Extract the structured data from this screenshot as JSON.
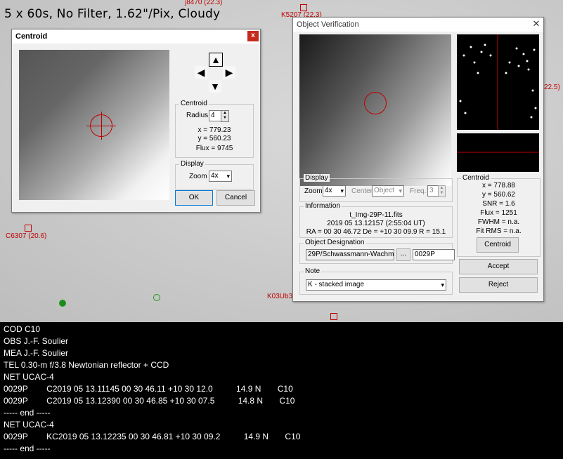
{
  "overlay": {
    "title": "5 x 60s, No Filter, 1.62\"/Pix, Cloudy",
    "marks": [
      "j8470 (22.3)",
      "K5207 (22.3)",
      "C6307 (20.6)",
      "K03Ub3",
      "22.5)"
    ]
  },
  "centroid_window": {
    "title": "Centroid",
    "close_label": "x",
    "group_label": "Centroid",
    "radius_label": "Radius",
    "radius_value": "4",
    "x": "x = 779.23",
    "y": "y = 560.23",
    "flux": "Flux = 9745",
    "display_label": "Display",
    "zoom_label": "Zoom",
    "zoom_value": "4x",
    "ok_label": "OK",
    "cancel_label": "Cancel",
    "arrows": {
      "up": "▲",
      "down": "▼",
      "left": "◀",
      "right": "▶"
    }
  },
  "verify_window": {
    "title": "Object Verification",
    "close_label": "✕",
    "display_label": "Display",
    "zoom_label": "Zoom",
    "zoom_value": "4x",
    "center_label": "Center",
    "center_value": "Object",
    "freq_label": "Freq.",
    "freq_value": "3",
    "info_label": "Information",
    "info_file": "t_Img-29P-11.fits",
    "info_date": "2019 05 13.12157 (2:55:04 UT)",
    "info_coords": "RA = 00 30 46.72   De = +10 30 09.9   R = 15.1",
    "designation_label": "Object Designation",
    "designation_value": "29P/Schwassmann-Wachm",
    "browse_label": "...",
    "designation_code": "0029P",
    "note_label": "Note",
    "note_value": "K - stacked image",
    "centroid_label": "Centroid",
    "c_x": "x = 778.88",
    "c_y": "y = 560.62",
    "c_snr": "SNR = 1.6",
    "c_flux": "Flux = 1251",
    "c_fwhm": "FWHM = n.a.",
    "c_fitrms": "Fit RMS = n.a.",
    "centroid_button": "Centroid",
    "accept_button": "Accept",
    "reject_button": "Reject"
  },
  "console_lines": [
    "COD C10",
    "OBS J.-F. Soulier",
    "MEA J.-F. Soulier",
    "TEL 0.30-m f/3.8 Newtonian reflector + CCD",
    "NET UCAC-4",
    "0029P        C2019 05 13.11145 00 30 46.11 +10 30 12.0          14.9 N       C10",
    "0029P        C2019 05 13.12390 00 30 46.85 +10 30 07.5          14.8 N       C10",
    "----- end -----",
    "NET UCAC-4",
    "0029P        KC2019 05 13.12235 00 30 46.81 +10 30 09.2          14.9 N       C10",
    "----- end -----"
  ]
}
